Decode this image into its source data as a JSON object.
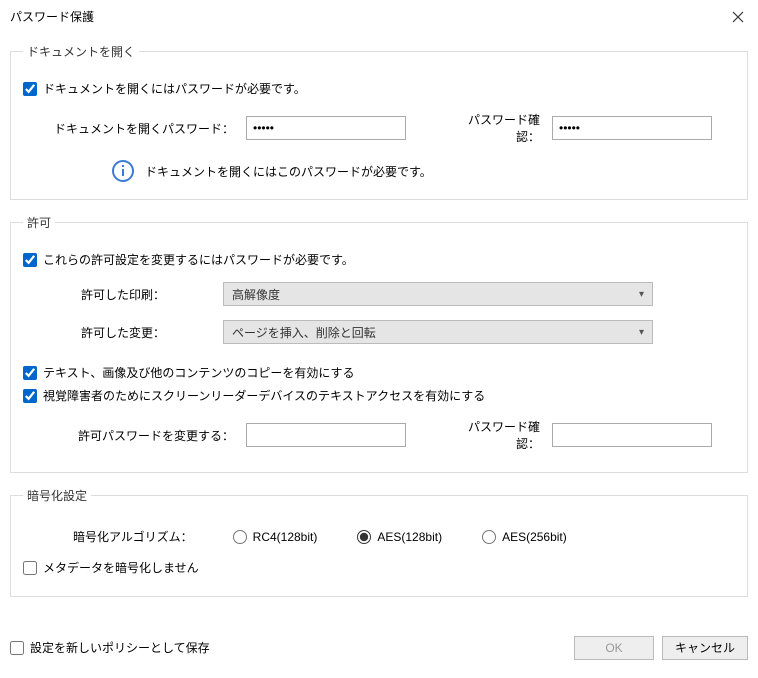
{
  "title": "パスワード保護",
  "open_section": {
    "legend": "ドキュメントを開く",
    "cb_label": "ドキュメントを開くにはパスワードが必要です。",
    "pw_label": "ドキュメントを開くパスワード：",
    "pw_value": "•••••",
    "confirm_label": "パスワード確認：",
    "confirm_value": "•••••",
    "info_text": "ドキュメントを開くにはこのパスワードが必要です。"
  },
  "perm_section": {
    "legend": "許可",
    "cb_label": "これらの許可設定を変更するにはパスワードが必要です。",
    "print_label": "許可した印刷：",
    "print_value": "高解像度",
    "change_label": "許可した変更：",
    "change_value": "ページを挿入、削除と回転",
    "cb_copy": "テキスト、画像及び他のコンテンツのコピーを有効にする",
    "cb_screen": "視覚障害者のためにスクリーンリーダーデバイスのテキストアクセスを有効にする",
    "perm_pw_label": "許可パスワードを変更する：",
    "confirm_label": "パスワード確認："
  },
  "enc_section": {
    "legend": "暗号化設定",
    "algo_label": "暗号化アルゴリズム：",
    "opt_rc4": "RC4(128bit)",
    "opt_aes128": "AES(128bit)",
    "opt_aes256": "AES(256bit)",
    "cb_meta": "メタデータを暗号化しません"
  },
  "footer": {
    "save_policy": "設定を新しいポリシーとして保存",
    "ok": "OK",
    "cancel": "キャンセル"
  }
}
